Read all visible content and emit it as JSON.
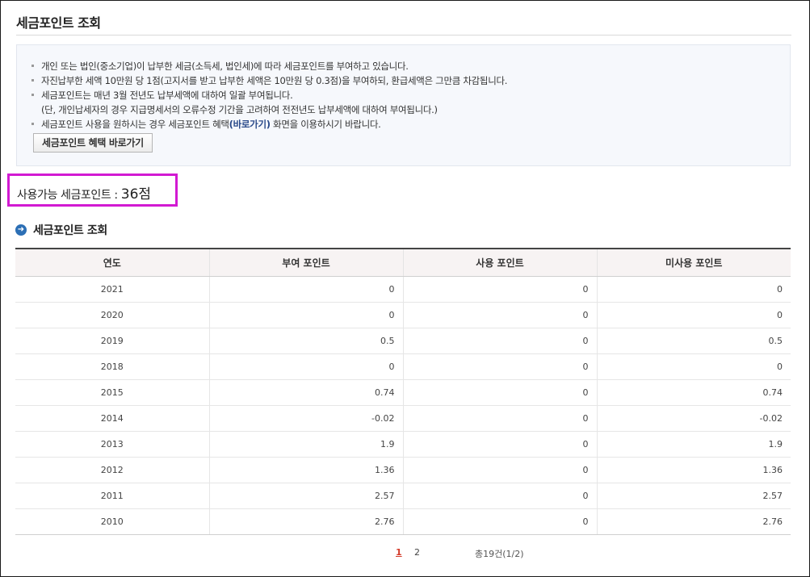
{
  "page": {
    "title": "세금포인트 조회"
  },
  "notice": {
    "lines": [
      "개인 또는 법인(중소기업)이 납부한 세금(소득세, 법인세)에 따라 세금포인트를 부여하고 있습니다.",
      "자진납부한 세액 10만원 당 1점(고지서를 받고 납부한 세액은 10만원 당 0.3점)을 부여하되, 환급세액은 그만큼 차감됩니다.",
      "세금포인트는 매년 3월 전년도 납부세액에 대하여 일괄 부여됩니다."
    ],
    "sub_line": "(단, 개인납세자의 경우 지급명세서의 오류수정 기간을 고려하여 전전년도 납부세액에 대하여 부여됩니다.)",
    "last_line_prefix": "세금포인트 사용을 원하시는 경우 세금포인트 혜택",
    "last_line_link": "(바로가기)",
    "last_line_suffix": " 화면을 이용하시기 바랍니다.",
    "button_label": "세금포인트 혜택 바로가기"
  },
  "available": {
    "label": "사용가능 세금포인트 : ",
    "value": "36점"
  },
  "section": {
    "title": "세금포인트 조회"
  },
  "table": {
    "headers": [
      "연도",
      "부여 포인트",
      "사용 포인트",
      "미사용 포인트"
    ],
    "rows": [
      [
        "2021",
        "0",
        "0",
        "0"
      ],
      [
        "2020",
        "0",
        "0",
        "0"
      ],
      [
        "2019",
        "0.5",
        "0",
        "0.5"
      ],
      [
        "2018",
        "0",
        "0",
        "0"
      ],
      [
        "2015",
        "0.74",
        "0",
        "0.74"
      ],
      [
        "2014",
        "-0.02",
        "0",
        "-0.02"
      ],
      [
        "2013",
        "1.9",
        "0",
        "1.9"
      ],
      [
        "2012",
        "1.36",
        "0",
        "1.36"
      ],
      [
        "2011",
        "2.57",
        "0",
        "2.57"
      ],
      [
        "2010",
        "2.76",
        "0",
        "2.76"
      ]
    ]
  },
  "pagination": {
    "pages": [
      "1",
      "2"
    ],
    "current": "1",
    "total": "총19건(1/2)"
  },
  "colors": {
    "highlight_border": "#d21ad2",
    "link": "#2a4a8a",
    "current_page": "#d43b2a"
  }
}
